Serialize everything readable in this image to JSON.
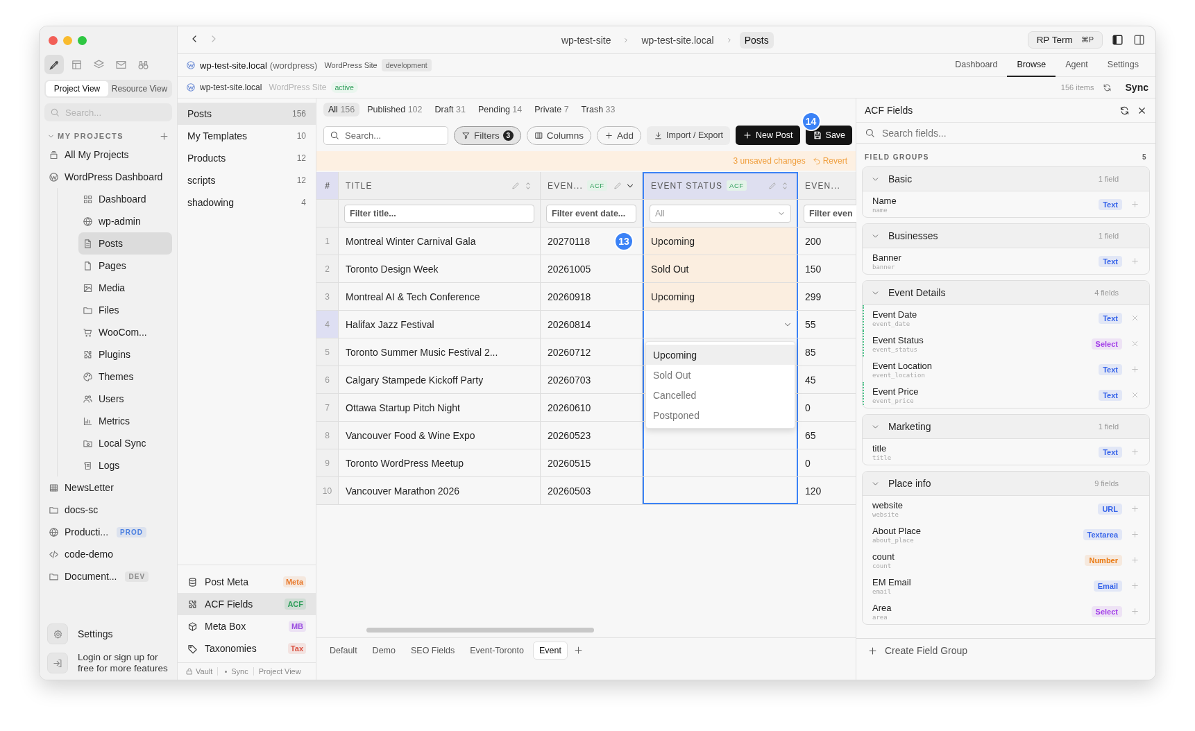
{
  "sidebar": {
    "tools": [
      {
        "kind": "pen",
        "selected": true
      },
      {
        "kind": "layout",
        "selected": false
      },
      {
        "kind": "layers",
        "selected": false
      },
      {
        "kind": "mail",
        "selected": false
      },
      {
        "kind": "binoculars",
        "selected": false
      }
    ],
    "view_tabs": [
      {
        "label": "Project View",
        "selected": true
      },
      {
        "label": "Resource View",
        "selected": false
      }
    ],
    "search": {
      "placeholder": "Search..."
    },
    "section": {
      "label": "MY PROJECTS",
      "expanded": true
    },
    "projects": [
      {
        "label": "All My Projects",
        "kind": "stack",
        "selected": false
      },
      {
        "label": "WordPress Dashboard",
        "kind": "logo",
        "selected": false,
        "children": [
          {
            "label": "Dashboard",
            "kind": "grid",
            "selected": false
          },
          {
            "label": "wp-admin",
            "kind": "globe",
            "selected": false
          },
          {
            "label": "Posts",
            "kind": "document",
            "selected": true
          },
          {
            "label": "Pages",
            "kind": "page",
            "selected": false
          },
          {
            "label": "Media",
            "kind": "image",
            "selected": false
          },
          {
            "label": "Files",
            "kind": "folder",
            "selected": false
          },
          {
            "label": "WooCom...",
            "kind": "cart",
            "selected": false
          },
          {
            "label": "Plugins",
            "kind": "puzzle",
            "selected": false
          },
          {
            "label": "Themes",
            "kind": "palette",
            "selected": false
          },
          {
            "label": "Users",
            "kind": "users",
            "selected": false
          },
          {
            "label": "Metrics",
            "kind": "bar-chart",
            "selected": false
          },
          {
            "label": "Local Sync",
            "kind": "folder-sync",
            "selected": false
          },
          {
            "label": "Logs",
            "kind": "scroll",
            "selected": false
          }
        ]
      },
      {
        "label": "NewsLetter",
        "kind": "table",
        "selected": false
      },
      {
        "label": "docs-sc",
        "kind": "folder",
        "selected": false
      },
      {
        "label": "Producti...",
        "kind": "globe",
        "selected": false,
        "tag": {
          "label": "PROD",
          "color": "#4a7fe0"
        }
      },
      {
        "label": "code-demo",
        "kind": "code",
        "selected": false
      },
      {
        "label": "Document...",
        "kind": "folder",
        "selected": false,
        "tag": {
          "label": "DEV",
          "color": "#8a8a8a"
        }
      }
    ],
    "settings": "Settings",
    "login": "Login or sign up for free for more features"
  },
  "topbar": {
    "breadcrumb": [
      {
        "label": "wp-test-site",
        "selected": false
      },
      {
        "label": "wp-test-site.local",
        "selected": false
      },
      {
        "label": "Posts",
        "selected": true
      }
    ],
    "terminal": {
      "label": "RP Term",
      "shortcut": "⌘P"
    },
    "panel_toggles": [
      {
        "kind": "panel-left",
        "on": true
      },
      {
        "kind": "panel-right",
        "on": false
      }
    ]
  },
  "site": {
    "name": "wp-test-site.local",
    "platform": "(wordpress)",
    "type": "WordPress Site",
    "env": "development",
    "tabs": [
      {
        "label": "Dashboard",
        "selected": false
      },
      {
        "label": "Browse",
        "selected": true
      },
      {
        "label": "Agent",
        "selected": false
      },
      {
        "label": "Settings",
        "selected": false
      }
    ]
  },
  "site_status": {
    "name": "wp-test-site.local",
    "type": "WordPress Site",
    "status": "active",
    "count": "156 items",
    "sync": "Sync"
  },
  "collections": {
    "items": [
      {
        "label": "Posts",
        "count": "156",
        "selected": true
      },
      {
        "label": "My Templates",
        "count": "10",
        "selected": false
      },
      {
        "label": "Products",
        "count": "12",
        "selected": false
      },
      {
        "label": "scripts",
        "count": "12",
        "selected": false
      },
      {
        "label": "shadowing",
        "count": "4",
        "selected": false
      }
    ],
    "sources": [
      {
        "label": "Post Meta",
        "kind": "database",
        "tag": "Meta",
        "color": "#e8782a",
        "selected": false
      },
      {
        "label": "ACF Fields",
        "kind": "puzzle",
        "tag": "ACF",
        "color": "#2f9e5a",
        "selected": true
      },
      {
        "label": "Meta Box",
        "kind": "cube",
        "tag": "MB",
        "color": "#9b4de0",
        "selected": false
      },
      {
        "label": "Taxonomies",
        "kind": "tag",
        "tag": "Tax",
        "color": "#d9503f",
        "selected": false
      }
    ],
    "status_bar": [
      {
        "label": "Vault",
        "kind": "lock"
      },
      {
        "label": "Sync",
        "kind": "dot"
      },
      {
        "label": "Project View",
        "kind": "none"
      }
    ]
  },
  "table": {
    "status_tabs": [
      {
        "label": "All",
        "count": "156",
        "selected": true
      },
      {
        "label": "Published",
        "count": "102",
        "selected": false
      },
      {
        "label": "Draft",
        "count": "31",
        "selected": false
      },
      {
        "label": "Pending",
        "count": "14",
        "selected": false
      },
      {
        "label": "Private",
        "count": "7",
        "selected": false
      },
      {
        "label": "Trash",
        "count": "33",
        "selected": false
      }
    ],
    "search": {
      "placeholder": "Search..."
    },
    "toolbar": [
      {
        "label": "Filters",
        "kind": "filter",
        "count": "3",
        "on": true
      },
      {
        "label": "Columns",
        "kind": "columns"
      },
      {
        "label": "Add",
        "kind": "add"
      },
      {
        "label": "Import / Export",
        "kind": "import"
      },
      {
        "label": "New Post",
        "kind": "new"
      },
      {
        "label": "Save",
        "kind": "save",
        "marker": "14"
      }
    ],
    "unsaved": {
      "message": "3 unsaved changes",
      "action": "Revert"
    },
    "columns": [
      {
        "label": "#",
        "kind": "index",
        "selected": false
      },
      {
        "label": "TITLE",
        "kind": "field",
        "sorted": false,
        "selected": false,
        "filter": {
          "kind": "text",
          "placeholder": "Filter title..."
        }
      },
      {
        "label": "EVEN...",
        "kind": "field",
        "acf": "ACF",
        "sorted": true,
        "selected": false,
        "filter": {
          "kind": "text",
          "placeholder": "Filter event date..."
        }
      },
      {
        "label": "EVENT STATUS",
        "kind": "field",
        "acf": "ACF",
        "sorted": false,
        "selected": true,
        "filter": {
          "kind": "select",
          "value": "All"
        }
      },
      {
        "label": "EVEN...",
        "kind": "field",
        "selected": false,
        "filter": {
          "kind": "text",
          "placeholder": "Filter even"
        }
      }
    ],
    "rows": [
      {
        "num": "1",
        "title": "Montreal Winter Carnival Gala",
        "date": "20270118",
        "status": "Upcoming",
        "price": "200",
        "edited": true,
        "selected": false,
        "editing": false,
        "marker": "13"
      },
      {
        "num": "2",
        "title": "Toronto Design Week",
        "date": "20261005",
        "status": "Sold Out",
        "price": "150",
        "edited": true,
        "selected": false,
        "editing": false
      },
      {
        "num": "3",
        "title": "Montreal AI & Tech Conference",
        "date": "20260918",
        "status": "Upcoming",
        "price": "299",
        "edited": true,
        "selected": false,
        "editing": false
      },
      {
        "num": "4",
        "title": "Halifax Jazz Festival",
        "date": "20260814",
        "price": "55",
        "edited": false,
        "selected": true,
        "editing": true
      },
      {
        "num": "5",
        "title": "Toronto Summer Music Festival 2...",
        "date": "20260712",
        "price": "85",
        "edited": false,
        "selected": false,
        "editing": false
      },
      {
        "num": "6",
        "title": "Calgary Stampede Kickoff Party",
        "date": "20260703",
        "price": "45",
        "edited": false,
        "selected": false,
        "editing": false
      },
      {
        "num": "7",
        "title": "Ottawa Startup Pitch Night",
        "date": "20260610",
        "price": "0",
        "edited": false,
        "selected": false,
        "editing": false
      },
      {
        "num": "8",
        "title": "Vancouver Food & Wine Expo",
        "date": "20260523",
        "price": "65",
        "edited": false,
        "selected": false,
        "editing": false
      },
      {
        "num": "9",
        "title": "Toronto WordPress Meetup",
        "date": "20260515",
        "price": "0",
        "edited": false,
        "selected": false,
        "editing": false
      },
      {
        "num": "10",
        "title": "Vancouver Marathon 2026",
        "date": "20260503",
        "price": "120",
        "edited": false,
        "selected": false,
        "editing": false
      }
    ],
    "dropdown": [
      {
        "label": "Upcoming",
        "selected": true
      },
      {
        "label": "Sold Out",
        "selected": false
      },
      {
        "label": "Cancelled",
        "selected": false
      },
      {
        "label": "Postponed",
        "selected": false
      }
    ],
    "views": [
      {
        "label": "Default",
        "selected": false
      },
      {
        "label": "Demo",
        "selected": false
      },
      {
        "label": "SEO Fields",
        "selected": false
      },
      {
        "label": "Event-Toronto",
        "selected": false
      },
      {
        "label": "Event",
        "selected": true
      }
    ]
  },
  "acf": {
    "title": "ACF Fields",
    "search": {
      "placeholder": "Search fields..."
    },
    "section": "FIELD GROUPS",
    "count": "5",
    "groups": [
      {
        "name": "Basic",
        "count": "1 field",
        "expanded": true,
        "fields": [
          {
            "label": "Name",
            "key": "name",
            "type": "Text",
            "color": "#3563e9",
            "in_table": false
          }
        ]
      },
      {
        "name": "Businesses",
        "count": "1 field",
        "expanded": true,
        "fields": [
          {
            "label": "Banner",
            "key": "banner",
            "type": "Text",
            "color": "#3563e9",
            "in_table": false
          }
        ]
      },
      {
        "name": "Event Details",
        "count": "4 fields",
        "expanded": true,
        "fields": [
          {
            "label": "Event Date",
            "key": "event_date",
            "type": "Text",
            "color": "#3563e9",
            "in_table": true
          },
          {
            "label": "Event Status",
            "key": "event_status",
            "type": "Select",
            "color": "#a23ee8",
            "in_table": true
          },
          {
            "label": "Event Location",
            "key": "event_location",
            "type": "Text",
            "color": "#3563e9",
            "in_table": false
          },
          {
            "label": "Event Price",
            "key": "event_price",
            "type": "Text",
            "color": "#3563e9",
            "in_table": true
          }
        ]
      },
      {
        "name": "Marketing",
        "count": "1 field",
        "expanded": true,
        "fields": [
          {
            "label": "title",
            "key": "title",
            "type": "Text",
            "color": "#3563e9",
            "in_table": false
          }
        ]
      },
      {
        "name": "Place info",
        "count": "9 fields",
        "expanded": true,
        "fields": [
          {
            "label": "website",
            "key": "website",
            "type": "URL",
            "color": "#3563e9",
            "in_table": false
          },
          {
            "label": "About Place",
            "key": "about_place",
            "type": "Textarea",
            "color": "#3563e9",
            "in_table": false
          },
          {
            "label": "count",
            "key": "count",
            "type": "Number",
            "color": "#ea7a12",
            "in_table": false
          },
          {
            "label": "EM Email",
            "key": "email",
            "type": "Email",
            "color": "#3563e9",
            "in_table": false
          },
          {
            "label": "Area",
            "key": "area",
            "type": "Select",
            "color": "#a23ee8",
            "in_table": false
          }
        ]
      }
    ],
    "create": "Create Field Group"
  }
}
